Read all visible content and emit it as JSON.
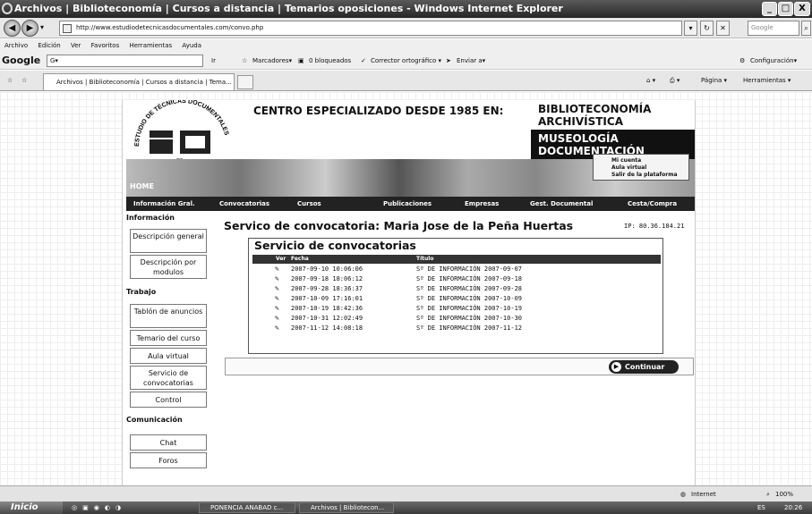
{
  "window": {
    "title": "Archivos | Biblioteconomía | Cursos a distancia | Temarios oposiciones - Windows Internet Explorer",
    "minimize": "_",
    "maximize": "□",
    "close": "X"
  },
  "address": {
    "url": "http://www.estudiodetecnicasdocumentales.com/convo.php",
    "search_placeholder": "Google"
  },
  "menu": [
    "Archivo",
    "Edición",
    "Ver",
    "Favoritos",
    "Herramientas",
    "Ayuda"
  ],
  "gtoolbar": {
    "logo": "Google",
    "search_value": "G▾",
    "ir": "Ir",
    "marcadores": "Marcadores▾",
    "bloqueados": "0 bloqueados",
    "corrector": "Corrector ortográfico ▾",
    "enviar": "Enviar a▾",
    "configuracion": "Configuración▾"
  },
  "tabs": {
    "label": "Archivos | Biblioteconomía | Cursos a distancia | Tema...",
    "pagina": "Página ▾",
    "herramientas": "Herramientas ▾"
  },
  "site": {
    "logo_arc": "ESTUDIO DE TÉCNICAS DOCUMENTALES",
    "logo_letters": "ED",
    "headline": "CENTRO ESPECIALIZADO DESDE 1985 EN:",
    "areas_top": [
      "BIBLIOTECONOMÍA",
      "ARCHIVÍSTICA"
    ],
    "areas_bottom": [
      "MUSEOLOGÍA",
      "DOCUMENTACIÓN"
    ],
    "home": "HOME",
    "account": [
      "Mi cuenta",
      "Aula virtual",
      "Salir de la plataforma"
    ],
    "nav": [
      "Información Gral.",
      "Convocatorias",
      "Cursos",
      "Publicaciones",
      "Empresas",
      "Gest. Documental",
      "Cesta/Compra"
    ]
  },
  "sidebar": {
    "h1": "Información",
    "h2": "Trabajo",
    "h3": "Comunicación",
    "items": [
      "Descripción general",
      "Descripción por modulos",
      "Tablón de anuncios",
      "Temario del curso",
      "Aula virtual",
      "Servicio de convocatorias",
      "Control",
      "Chat",
      "Foros"
    ]
  },
  "main": {
    "title": "Servico de convocatoria: Maria Jose de la Peña Huertas",
    "ip": "IP: 80.36.184.21",
    "box_title": "Servicio de convocatorias",
    "columns": [
      "Ver",
      "Fecha",
      "Título"
    ],
    "rows": [
      {
        "fecha": "2007-09-10 10:06:06",
        "titulo": "Sº DE INFORMACIÓN 2007-09-07"
      },
      {
        "fecha": "2007-09-18 18:06:12",
        "titulo": "Sº DE INFORMACIÓN 2007-09-18"
      },
      {
        "fecha": "2007-09-28 18:36:37",
        "titulo": "Sº DE INFORMACIÓN 2007-09-28"
      },
      {
        "fecha": "2007-10-09 17:16:01",
        "titulo": "Sº DE INFORMACIÓN 2007-10-09"
      },
      {
        "fecha": "2007-10-19 18:42:36",
        "titulo": "Sº DE INFORMACIÓN 2007-10-19"
      },
      {
        "fecha": "2007-10-31 12:02:49",
        "titulo": "Sº DE INFORMACIÓN 2007-10-30"
      },
      {
        "fecha": "2007-11-12 14:08:18",
        "titulo": "Sº DE INFORMACIÓN 2007-11-12"
      }
    ],
    "continue": "Continuar"
  },
  "status": {
    "zone": "Internet",
    "zoom": "100%"
  },
  "taskbar": {
    "start": "Inicio",
    "item1": "PONENCIA ANABAD c...",
    "item2": "Archivos | Bibliotecon...",
    "lang": "ES",
    "clock": "20:26"
  }
}
